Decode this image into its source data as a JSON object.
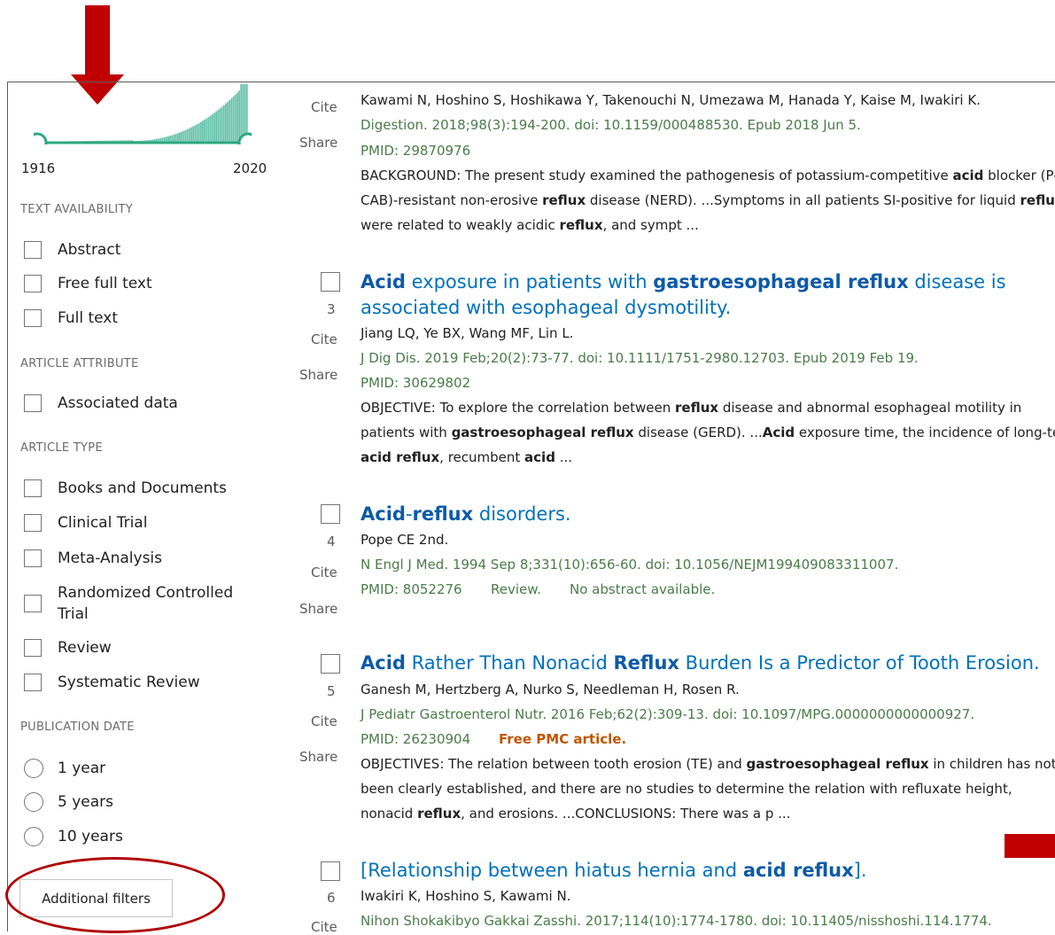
{
  "sidebar": {
    "year_start": "1916",
    "year_end": "2020",
    "text_availability": {
      "heading": "TEXT AVAILABILITY",
      "options": [
        "Abstract",
        "Free full text",
        "Full text"
      ]
    },
    "article_attribute": {
      "heading": "ARTICLE ATTRIBUTE",
      "options": [
        "Associated data"
      ]
    },
    "article_type": {
      "heading": "ARTICLE TYPE",
      "options": [
        "Books and Documents",
        "Clinical Trial",
        "Meta-Analysis",
        "Randomized Controlled",
        "Trial",
        "Review",
        "Systematic Review"
      ]
    },
    "publication_date": {
      "heading": "PUBLICATION DATE",
      "options": [
        "1 year",
        "5 years",
        "10 years"
      ]
    },
    "additional_filters": "Additional filters"
  },
  "results": [
    {
      "number": "",
      "cite": "Cite",
      "share": "Share",
      "authors": "Kawami N, Hoshino S, Hoshikawa Y, Takenouchi N, Umezawa M, Hanada Y, Kaise M, Iwakiri K.",
      "citation": "Digestion. 2018;98(3):194-200. doi: 10.1159/000488530. Epub 2018 Jun 5.",
      "pmid": "PMID: 29870976",
      "snippet": [
        [
          "BACKGROUND: The present study examined the pathogenesis of potassium-competitive ",
          "acid",
          " blocker (P-"
        ],
        [
          "CAB)-resistant non-erosive ",
          "reflux",
          " disease (NERD). ...Symptoms in all patients SI-positive for liquid ",
          "reflux"
        ],
        [
          "were related to weakly acidic ",
          "reflux",
          ", and sympt ..."
        ]
      ]
    },
    {
      "number": "3",
      "cite": "Cite",
      "share": "Share",
      "title_parts": [
        [
          "Acid",
          true
        ],
        [
          " exposure in patients with ",
          false
        ],
        [
          "gastroesophageal reflux",
          true
        ],
        [
          " disease is associated with esophageal dysmotility.",
          false
        ]
      ],
      "authors": "Jiang LQ, Ye BX, Wang MF, Lin L.",
      "citation": "J Dig Dis. 2019 Feb;20(2):73-77. doi: 10.1111/1751-2980.12703. Epub 2019 Feb 19.",
      "pmid": "PMID: 30629802",
      "snippet": [
        [
          "OBJECTIVE: To explore the correlation between ",
          "reflux",
          " disease and abnormal esophageal motility in"
        ],
        [
          "patients with ",
          "gastroesophageal reflux",
          " disease (GERD). ...",
          "Acid",
          " exposure time, the incidence of long-term"
        ],
        [
          "",
          "acid reflux",
          ", recumbent ",
          "acid",
          " ..."
        ]
      ]
    },
    {
      "number": "4",
      "cite": "Cite",
      "share": "Share",
      "title_parts": [
        [
          "Acid",
          true
        ],
        [
          "-",
          false
        ],
        [
          "reflux",
          true
        ],
        [
          " disorders.",
          false
        ]
      ],
      "authors": "Pope CE 2nd.",
      "citation": "N Engl J Med. 1994 Sep 8;331(10):656-60. doi: 10.1056/NEJM199409083311007.",
      "pmid": "PMID: 8052276",
      "review": "Review.",
      "no_abstract": "No abstract available."
    },
    {
      "number": "5",
      "cite": "Cite",
      "share": "Share",
      "title_parts": [
        [
          "Acid",
          true
        ],
        [
          " Rather Than Nonacid ",
          false
        ],
        [
          "Reflux",
          true
        ],
        [
          " Burden Is a Predictor of Tooth Erosion.",
          false
        ]
      ],
      "authors": "Ganesh M, Hertzberg A, Nurko S, Needleman H, Rosen R.",
      "citation": "J Pediatr Gastroenterol Nutr. 2016 Feb;62(2):309-13. doi: 10.1097/MPG.0000000000000927.",
      "pmid": "PMID: 26230904",
      "free_pmc": "Free PMC article.",
      "snippet": [
        [
          "OBJECTIVES: The relation between tooth erosion (TE) and ",
          "gastroesophageal reflux",
          " in children has not"
        ],
        [
          "been clearly established, and there are no studies to determine the relation with refluxate height,",
          "",
          ""
        ],
        [
          "nonacid ",
          "reflux",
          ", and erosions. ...CONCLUSIONS: There was a p ..."
        ]
      ]
    },
    {
      "number": "6",
      "cite": "Cite",
      "title_parts": [
        [
          "[Relationship between hiatus hernia and ",
          false
        ],
        [
          "acid reflux",
          true
        ],
        [
          "].",
          false
        ]
      ],
      "authors": "Iwakiri K, Hoshino S, Kawami N.",
      "citation": "Nihon Shokakibyo Gakkai Zasshi. 2017;114(10):1774-1780. doi: 10.11405/nisshoshi.114.1774."
    }
  ],
  "colors": {
    "annotation_red": "#c00000",
    "link_blue": "#0071bc",
    "citation_green": "#4a7c4a"
  }
}
